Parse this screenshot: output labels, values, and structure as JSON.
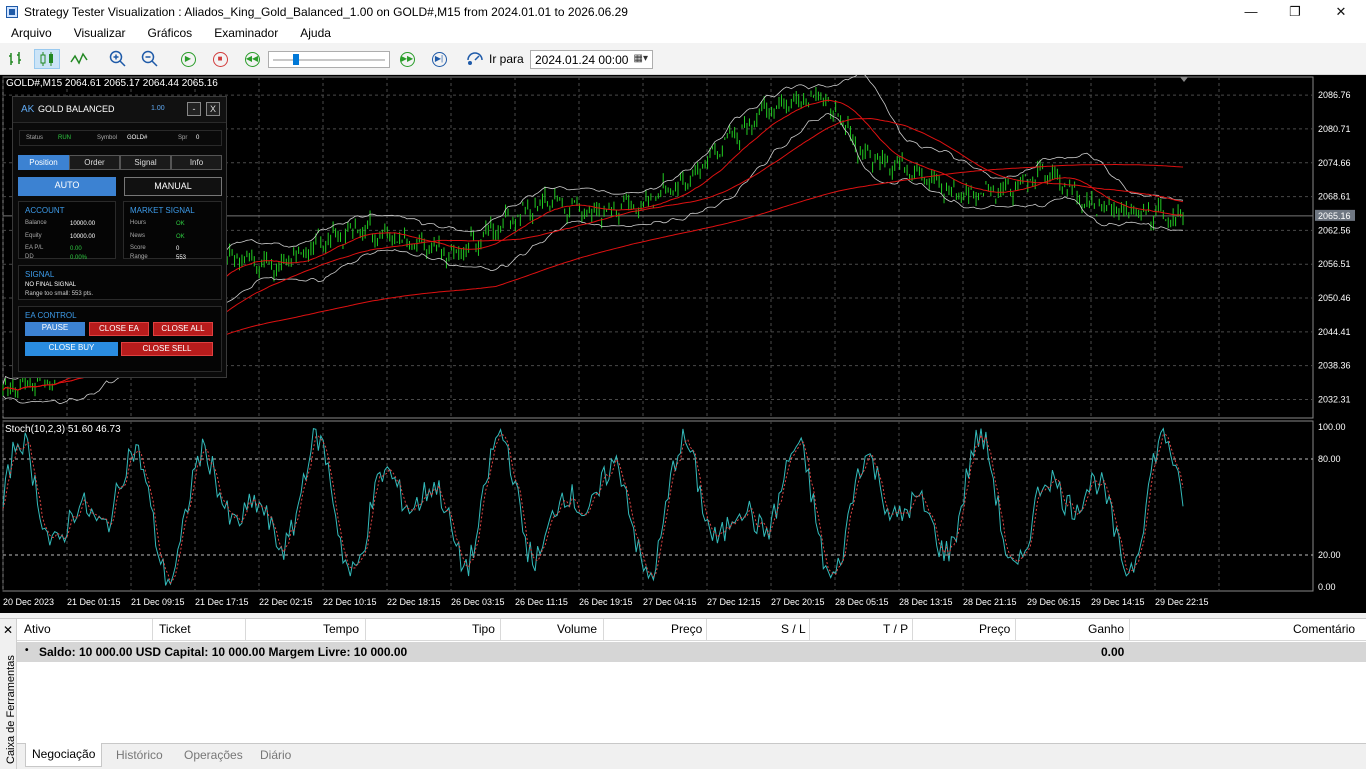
{
  "window": {
    "title": "Strategy Tester Visualization : Aliados_King_Gold_Balanced_1.00 on GOLD#,M15 from 2024.01.01 to 2026.06.29",
    "minimize_glyph": "—",
    "maximize_glyph": "❐",
    "close_glyph": "✕"
  },
  "menu": [
    "Arquivo",
    "Visualizar",
    "Gráficos",
    "Examinador",
    "Ajuda"
  ],
  "toolbar": {
    "goto_label": "Ir para",
    "goto_date": "2024.01.24 00:00",
    "icons": [
      "bar-chart-icon",
      "candlestick-icon",
      "line-chart-icon",
      "zoom-in-icon",
      "zoom-out-icon",
      "play-icon",
      "stop-icon",
      "rewind-icon",
      "fast-forward-icon",
      "step-forward-icon",
      "goto-icon"
    ],
    "slider_position": 0.2
  },
  "chart": {
    "ohlc_text": "GOLD#,M15  2064.61 2065.17 2064.44 2065.16",
    "price_labels": [
      "2086.76",
      "2080.71",
      "2074.66",
      "2068.61",
      "2062.56",
      "2056.51",
      "2050.46",
      "2044.41",
      "2038.36",
      "2032.31"
    ],
    "current_price": "2065.16",
    "stoch_label": "Stoch(10,2,3) 51.60 46.73",
    "stoch_levels": [
      "100.00",
      "80.00",
      "20.00",
      "0.00"
    ],
    "time_labels": [
      "20 Dec 2023",
      "21 Dec 01:15",
      "21 Dec 09:15",
      "21 Dec 17:15",
      "22 Dec 02:15",
      "22 Dec 10:15",
      "22 Dec 18:15",
      "26 Dec 03:15",
      "26 Dec 11:15",
      "26 Dec 19:15",
      "27 Dec 04:15",
      "27 Dec 12:15",
      "27 Dec 20:15",
      "28 Dec 05:15",
      "28 Dec 13:15",
      "28 Dec 21:15",
      "29 Dec 06:15",
      "29 Dec 14:15",
      "29 Dec 22:15"
    ],
    "colors": {
      "bg": "#000000",
      "candle": "#22cc22",
      "ma": "#dd1111",
      "bands": "#cccccc",
      "stoch_main": "#33bbbb",
      "stoch_signal": "#dd4444",
      "grid": "#4a4a4a"
    }
  },
  "chart_data": {
    "type": "line",
    "title": "",
    "series": [
      {
        "values": [
          2034,
          2036,
          2041,
          2046,
          2052,
          2058,
          2056,
          2061,
          2063,
          2060,
          2058,
          2064,
          2068,
          2066,
          2067,
          2071,
          2079,
          2085,
          2087,
          2076,
          2074,
          2069,
          2070,
          2073,
          2067,
          2066,
          2065
        ]
      }
    ],
    "ylim": [
      2029,
      2090
    ]
  },
  "ea_panel": {
    "logo": "AK",
    "name": "GOLD BALANCED",
    "version": "1.00",
    "min_btn": "-",
    "close_btn": "X",
    "status_label": "Status",
    "status_value": "RUN",
    "symbol_label": "Symbol",
    "symbol_value": "GOLD#",
    "spr_label": "Spr",
    "spr_value": "0",
    "tabs": [
      "Position",
      "Order",
      "Signal",
      "Info"
    ],
    "auto": "AUTO",
    "manual": "MANUAL",
    "account": {
      "title": "ACCOUNT",
      "balance_label": "Balance",
      "balance": "10000.00",
      "equity_label": "Equity",
      "equity": "10000.00",
      "pl_label": "EA P/L",
      "pl": "0.00",
      "dd_label": "DD",
      "dd": "0.00%"
    },
    "market": {
      "title": "MARKET SIGNAL",
      "hours_label": "Hours",
      "hours": "OK",
      "news_label": "News",
      "news": "OK",
      "score_label": "Score",
      "score": "0",
      "range_label": "Range",
      "range": "553"
    },
    "signal": {
      "title": "SIGNAL",
      "line1": "NO FINAL SIGNAL",
      "line2": "Range too small: 553 pts."
    },
    "control": {
      "title": "EA CONTROL",
      "pause": "PAUSE",
      "close_ea": "CLOSE EA",
      "close_all": "CLOSE ALL",
      "close_buy": "CLOSE BUY",
      "close_sell": "CLOSE SELL"
    }
  },
  "toolbox": {
    "close_glyph": "✕",
    "side_label": "Caixa de Ferramentas",
    "columns": [
      "Ativo",
      "Ticket",
      "Tempo",
      "Tipo",
      "Volume",
      "Preço",
      "S / L",
      "T / P",
      "Preço",
      "Ganho",
      "Comentário"
    ],
    "balance_text": "Saldo: 10 000.00 USD  Capital: 10 000.00  Margem Livre: 10 000.00",
    "balance_gain": "0.00",
    "tabs": [
      "Negociação",
      "Histórico",
      "Operações",
      "Diário"
    ]
  }
}
